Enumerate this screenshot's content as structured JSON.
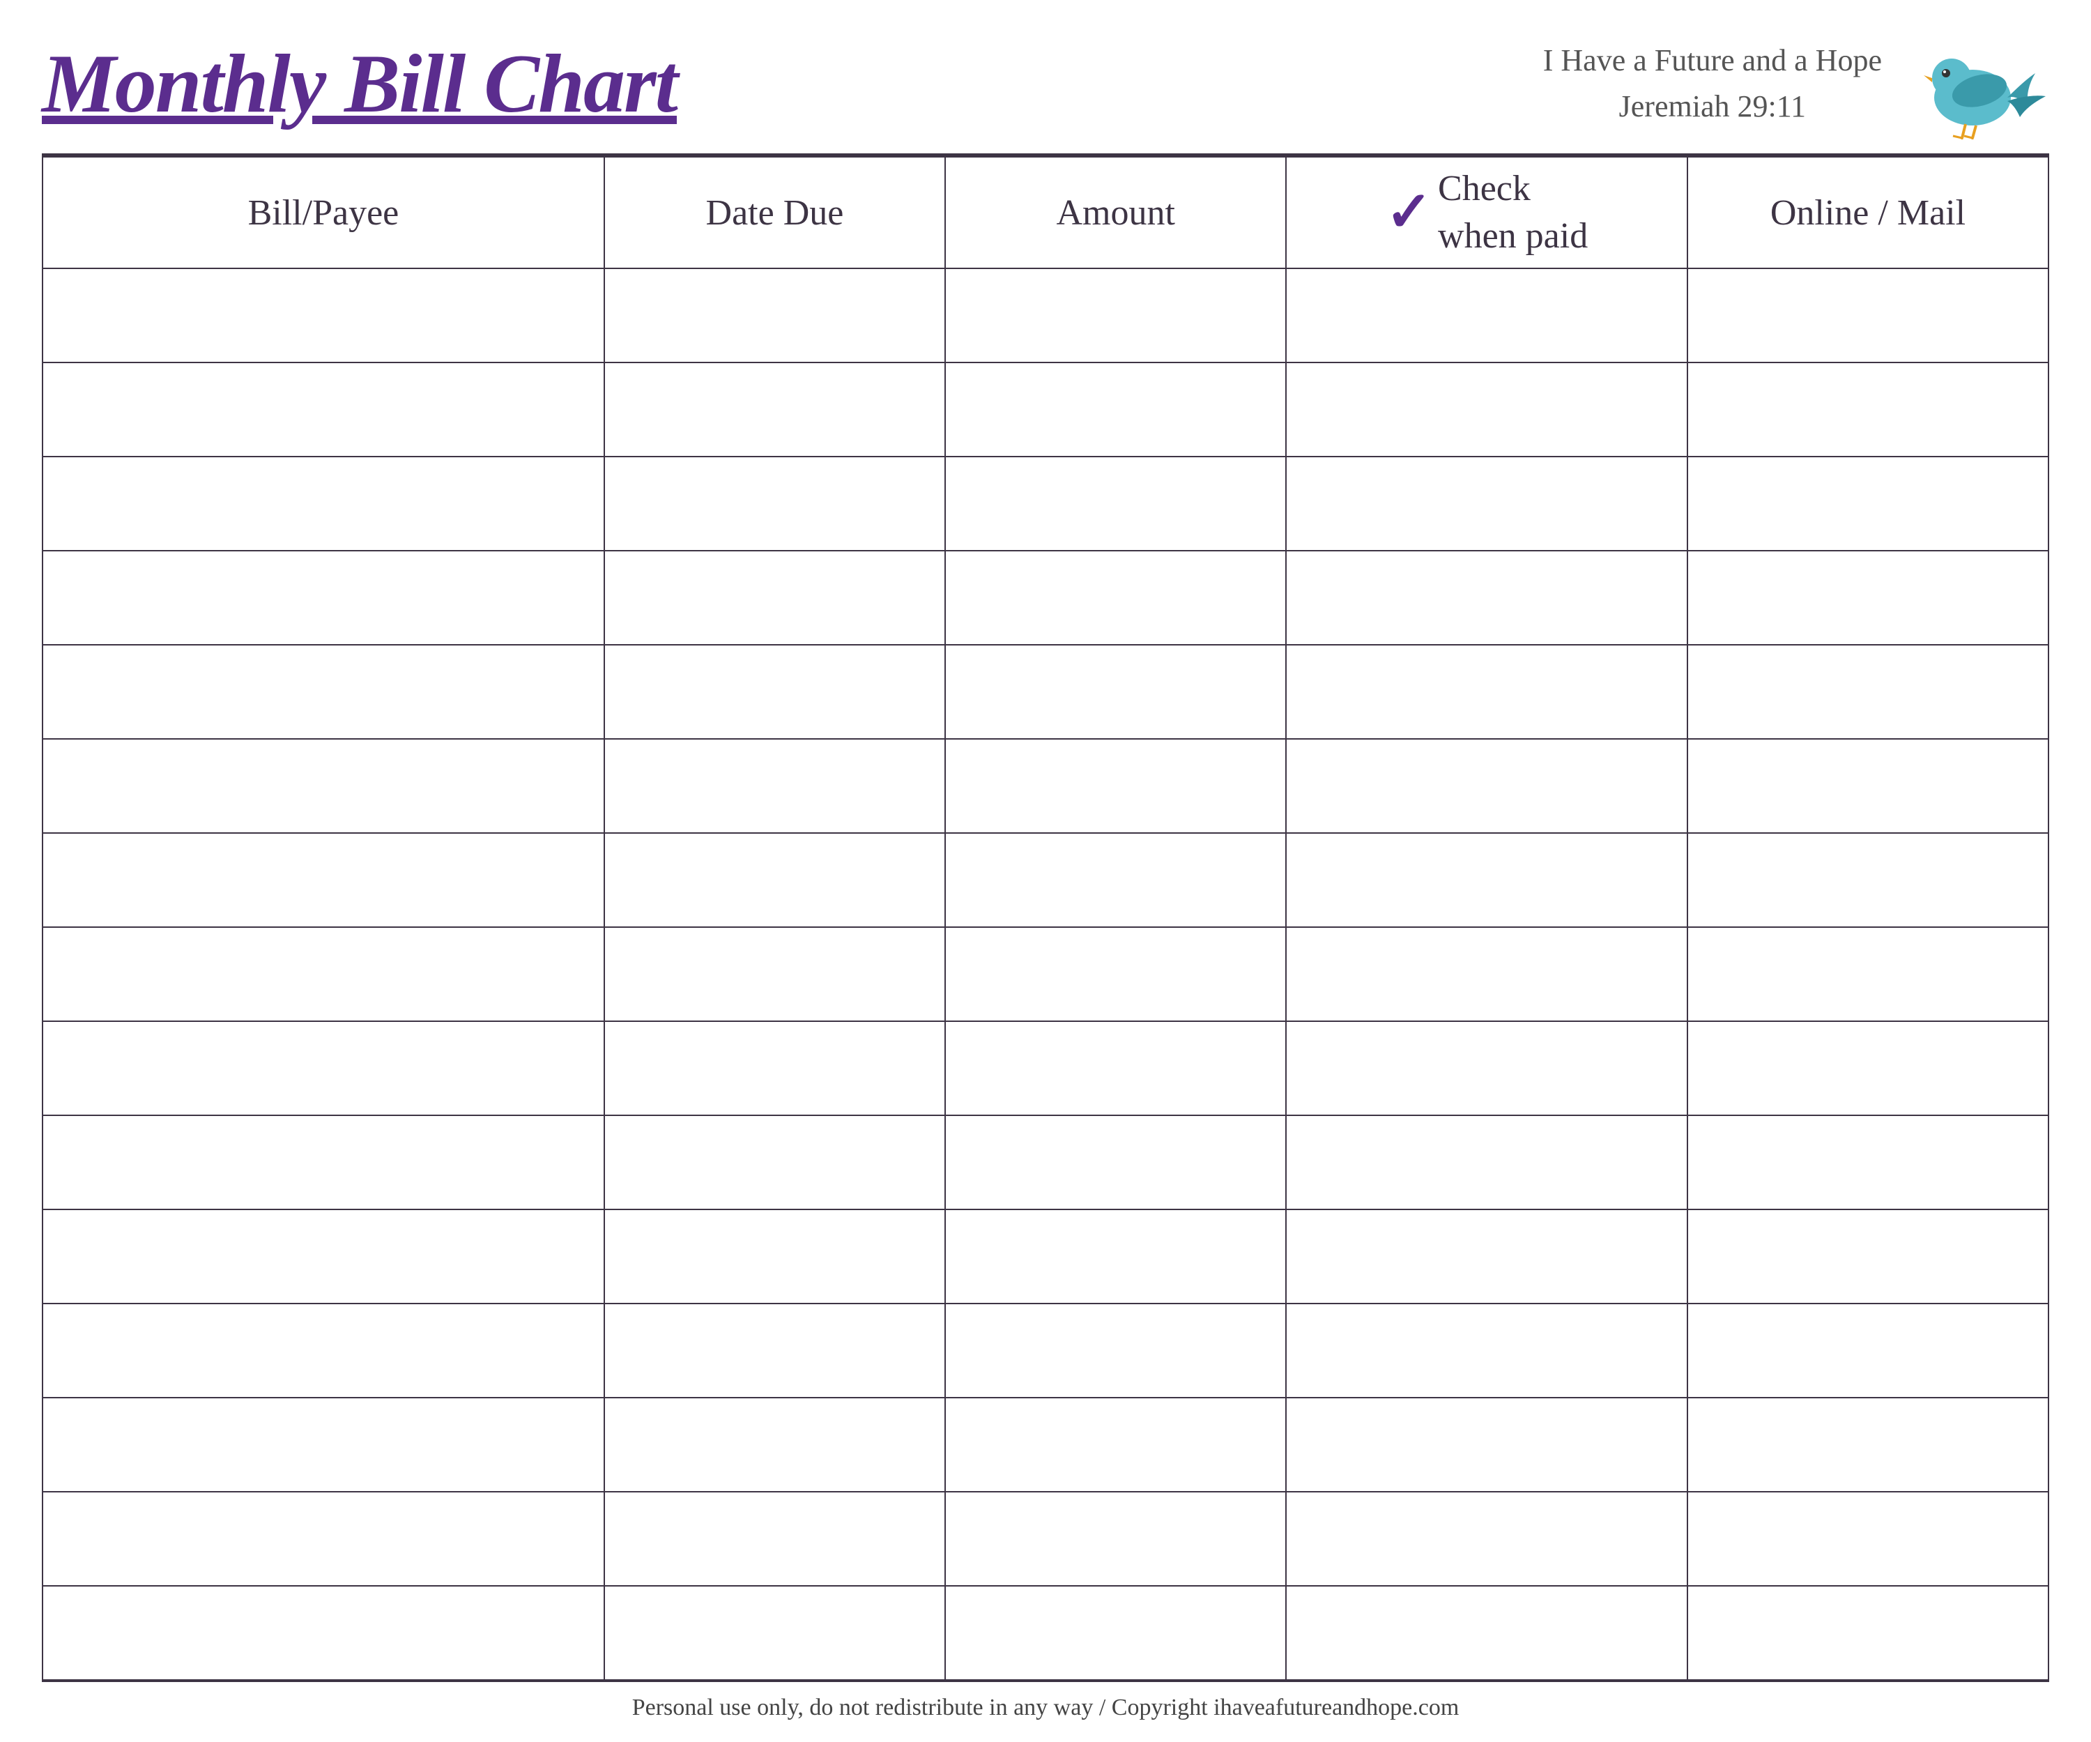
{
  "header": {
    "title": "Monthly Bill Chart",
    "verse_line1": "I Have a Future and a Hope",
    "verse_line2": "Jeremiah 29:11"
  },
  "table": {
    "columns": [
      {
        "key": "bill_payee",
        "label": "Bill/Payee"
      },
      {
        "key": "date_due",
        "label": "Date Due"
      },
      {
        "key": "amount",
        "label": "Amount"
      },
      {
        "key": "check_when_paid",
        "label_check": "Check",
        "label_when_paid": "when paid"
      },
      {
        "key": "online_mail",
        "label": "Online / Mail"
      }
    ],
    "row_count": 15
  },
  "footer": {
    "text": "Personal use only, do not redistribute in any way / Copyright ihaveafutureandhope.com"
  }
}
